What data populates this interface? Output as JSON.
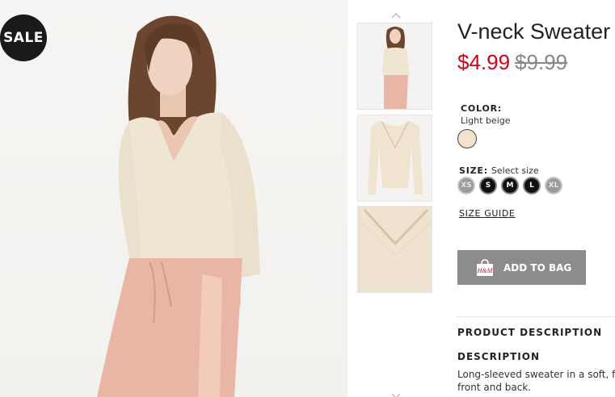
{
  "product": {
    "badge": "SALE",
    "title": "V-neck Sweater",
    "price_current": "$4.99",
    "price_original": "$9.99",
    "price_color": "#d0021b"
  },
  "color": {
    "label": "COLOR:",
    "value": "Light beige",
    "swatch_hex": "#f2e3cf"
  },
  "size": {
    "label": "SIZE:",
    "hint": "Select size",
    "options": [
      {
        "label": "XS",
        "available": false
      },
      {
        "label": "S",
        "available": true
      },
      {
        "label": "M",
        "available": true
      },
      {
        "label": "L",
        "available": true
      },
      {
        "label": "XL",
        "available": false
      }
    ],
    "guide_label": "SIZE GUIDE"
  },
  "actions": {
    "add_to_bag": "ADD TO BAG",
    "bag_logo": "H&M"
  },
  "description": {
    "section_title": "PRODUCT DESCRIPTION",
    "heading": "DESCRIPTION",
    "line1": "Long-sleeved sweater in a soft, fir",
    "line2": "front and back."
  },
  "icons": {
    "scroll_up": "chevron-up-icon",
    "scroll_down": "chevron-down-icon",
    "bag": "shopping-bag-icon"
  }
}
